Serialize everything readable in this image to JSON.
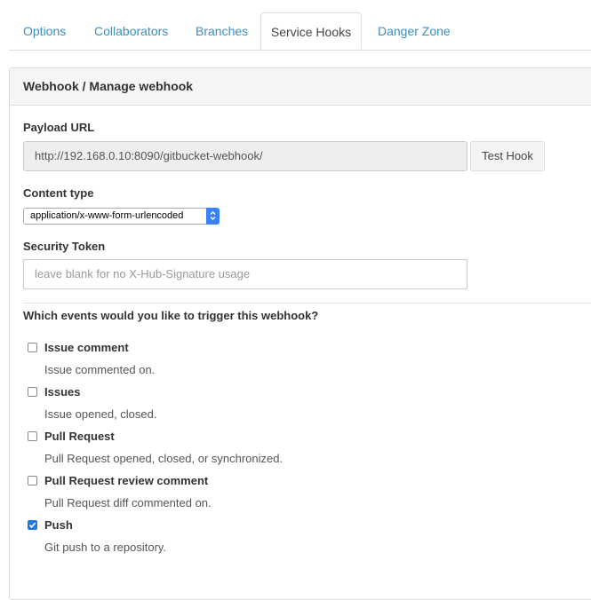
{
  "tabs": [
    {
      "label": "Options",
      "active": false
    },
    {
      "label": "Collaborators",
      "active": false
    },
    {
      "label": "Branches",
      "active": false
    },
    {
      "label": "Service Hooks",
      "active": true
    },
    {
      "label": "Danger Zone",
      "active": false
    }
  ],
  "panel": {
    "title": "Webhook / Manage webhook",
    "payload_url_label": "Payload URL",
    "payload_url_value": "http://192.168.0.10:8090/gitbucket-webhook/",
    "test_hook_label": "Test Hook",
    "content_type_label": "Content type",
    "content_type_value": "application/x-www-form-urlencoded",
    "security_token_label": "Security Token",
    "security_token_placeholder": "leave blank for no X-Hub-Signature usage",
    "events_question": "Which events would you like to trigger this webhook?",
    "events": [
      {
        "name": "Issue comment",
        "desc": "Issue commented on.",
        "checked": false
      },
      {
        "name": "Issues",
        "desc": "Issue opened, closed.",
        "checked": false
      },
      {
        "name": "Pull Request",
        "desc": "Pull Request opened, closed, or synchronized.",
        "checked": false
      },
      {
        "name": "Pull Request review comment",
        "desc": "Pull Request diff commented on.",
        "checked": false
      },
      {
        "name": "Push",
        "desc": "Git push to a repository.",
        "checked": true
      }
    ]
  },
  "colors": {
    "link": "#3c8dbc",
    "checkbox_checked": "#1f7ae0",
    "select_arrow": "#3a82f6"
  }
}
